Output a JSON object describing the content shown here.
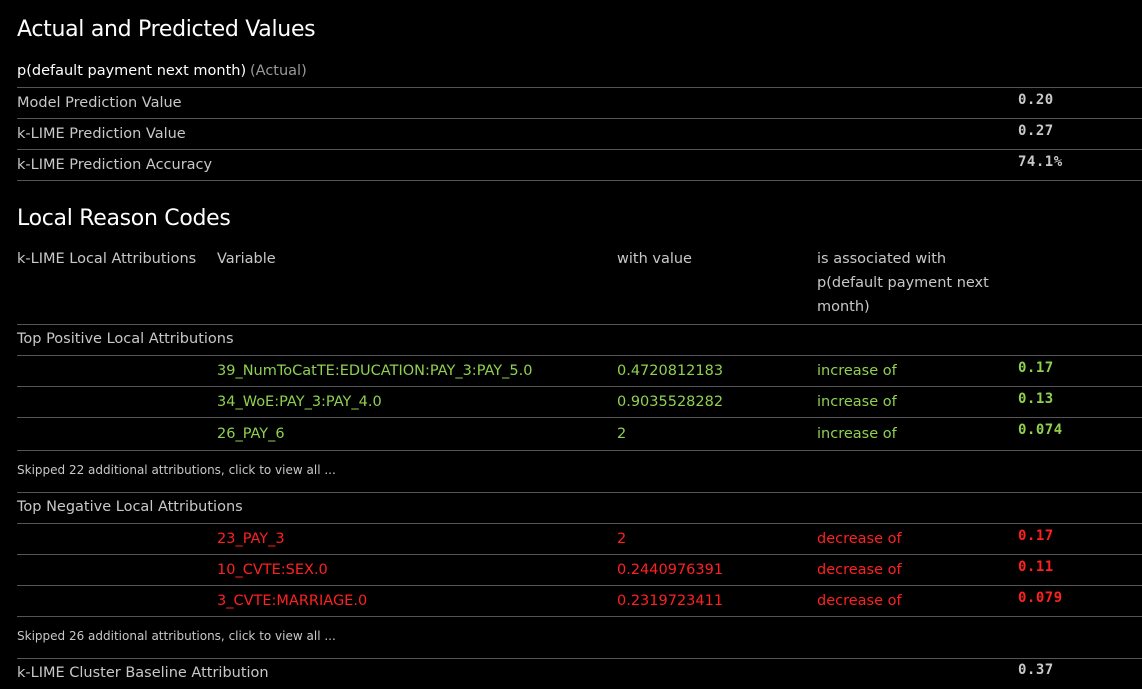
{
  "actual": {
    "title": "Actual and Predicted Values",
    "target_label": "p(default payment next month)",
    "target_suffix": "(Actual)",
    "rows": [
      {
        "label": "Model Prediction Value",
        "value": "0.20"
      },
      {
        "label": "k-LIME Prediction Value",
        "value": "0.27"
      },
      {
        "label": "k-LIME Prediction Accuracy",
        "value": "74.1%"
      }
    ]
  },
  "reason": {
    "title": "Local Reason Codes",
    "headers": {
      "attributions": "k-LIME Local Attributions",
      "variable": "Variable",
      "with_value": "with value",
      "assoc_line1": "is associated with",
      "assoc_line2": "p(default payment next",
      "assoc_line3": "month)"
    },
    "positive": {
      "title": "Top Positive Local Attributions",
      "rows": [
        {
          "variable": "39_NumToCatTE:EDUCATION:PAY_3:PAY_5.0",
          "value": "0.4720812183",
          "assoc": "increase of",
          "amount": "0.17"
        },
        {
          "variable": "34_WoE:PAY_3:PAY_4.0",
          "value": "0.9035528282",
          "assoc": "increase of",
          "amount": "0.13"
        },
        {
          "variable": "26_PAY_6",
          "value": "2",
          "assoc": "increase of",
          "amount": "0.074"
        }
      ],
      "skipped": "Skipped 22 additional attributions, click to view all ..."
    },
    "negative": {
      "title": "Top Negative Local Attributions",
      "rows": [
        {
          "variable": "23_PAY_3",
          "value": "2",
          "assoc": "decrease of",
          "amount": "0.17"
        },
        {
          "variable": "10_CVTE:SEX.0",
          "value": "0.2440976391",
          "assoc": "decrease of",
          "amount": "0.11"
        },
        {
          "variable": "3_CVTE:MARRIAGE.0",
          "value": "0.2319723411",
          "assoc": "decrease of",
          "amount": "0.079"
        }
      ],
      "skipped": "Skipped 26 additional attributions, click to view all ..."
    },
    "baseline": {
      "label": "k-LIME Cluster Baseline Attribution",
      "value": "0.37"
    }
  },
  "colors": {
    "positive": "#8fd14f",
    "negative": "#ff2020",
    "background": "#000000"
  }
}
